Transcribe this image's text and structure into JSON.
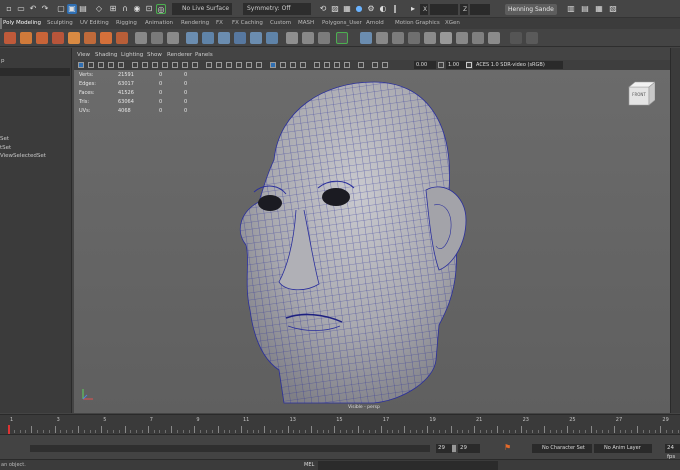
{
  "status_line": {
    "live_surface": "No Live Surface",
    "symmetry": "Symmetry: Off",
    "x_field": "X",
    "z_field": "Z",
    "user_account": "Henning Sande"
  },
  "shelf_tabs": [
    {
      "label": "Poly Modeling",
      "active": true
    },
    {
      "label": "Sculpting"
    },
    {
      "label": "UV Editing"
    },
    {
      "label": "Rigging"
    },
    {
      "label": "Animation"
    },
    {
      "label": "Rendering"
    },
    {
      "label": "FX"
    },
    {
      "label": "FX Caching"
    },
    {
      "label": "Custom"
    },
    {
      "label": "MASH"
    },
    {
      "label": "Polygons_User"
    },
    {
      "label": "Arnold"
    },
    {
      "label": "Motion Graphics"
    },
    {
      "label": "XGen"
    }
  ],
  "outliner": {
    "rows": [
      "p",
      "Set",
      "tSet",
      "ViewSelectedSet"
    ]
  },
  "panel_menu": [
    "View",
    "Shading",
    "Lighting",
    "Show",
    "Renderer",
    "Panels"
  ],
  "panel_toolbar": {
    "exposure": "0.00",
    "gamma": "1.00",
    "color_space": "ACES 1.0 SDR-video (sRGB)"
  },
  "hud": {
    "rows": [
      {
        "label": "Verts:",
        "value": "21591",
        "sel": "0",
        "extra": "0"
      },
      {
        "label": "Edges:",
        "value": "63017",
        "sel": "0",
        "extra": "0"
      },
      {
        "label": "Faces:",
        "value": "41526",
        "sel": "0",
        "extra": "0"
      },
      {
        "label": "Tris:",
        "value": "63064",
        "sel": "0",
        "extra": "0"
      },
      {
        "label": "UVs:",
        "value": "4068",
        "sel": "0",
        "extra": "0"
      }
    ]
  },
  "viewport": {
    "view_cube_label": "FRONT",
    "camera_label": "Visible - persp"
  },
  "time_slider": {
    "ticks": [
      "1",
      "",
      "3",
      "",
      "5",
      "",
      "7",
      "",
      "9",
      "",
      "11",
      "",
      "13",
      "",
      "15",
      "",
      "17",
      "",
      "19",
      "",
      "21",
      "",
      "23",
      "",
      "25",
      "",
      "27",
      "",
      "29",
      ""
    ]
  },
  "range_slider": {
    "end_field": "29",
    "end_field2": "29",
    "character_set": "No Character Set",
    "anim_layer": "No Anim Layer",
    "fps": "24 fps"
  },
  "command_line": {
    "help": "an object.",
    "mel": "MEL"
  },
  "colors": {
    "accent_blue": "#2f6fb3",
    "mesh_fill": "#a7a7ac",
    "wire": "#2a2f9c",
    "viewport_bg": "#666666"
  }
}
